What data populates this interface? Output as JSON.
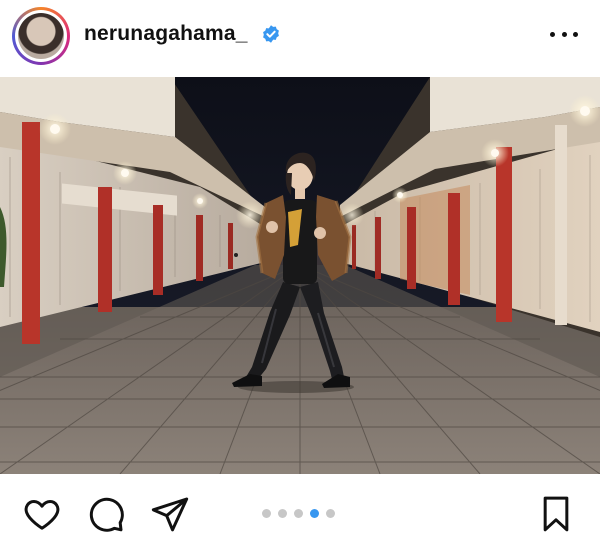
{
  "post": {
    "username": "nerunagahama_",
    "verified": true,
    "avatar_icon": "profile-avatar",
    "more_icon": "more-horizontal-icon"
  },
  "actions": {
    "like_icon": "heart-icon",
    "comment_icon": "comment-icon",
    "share_icon": "paper-plane-icon",
    "save_icon": "bookmark-icon"
  },
  "carousel": {
    "total": 5,
    "active_index": 3
  },
  "colors": {
    "verified_badge": "#3897f0",
    "active_dot": "#3897f0",
    "inactive_dot": "#c7c7c7",
    "icon": "#111111"
  }
}
